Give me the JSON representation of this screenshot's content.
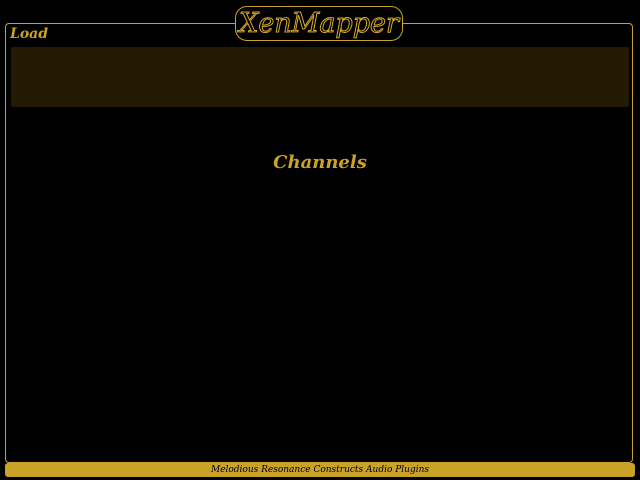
{
  "app": {
    "title": "XenMapper"
  },
  "load_section": {
    "label": "Load"
  },
  "channels_section": {
    "heading": "Channels"
  },
  "footer": {
    "text": "Melodious Resonance Constructs Audio Plugins"
  },
  "colors": {
    "background": "#000000",
    "accent_gold": "#c9a227",
    "panel_dark_gold": "#231a04"
  }
}
